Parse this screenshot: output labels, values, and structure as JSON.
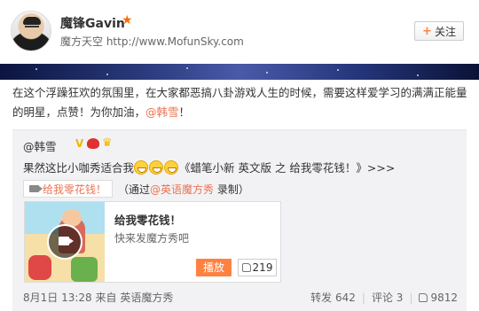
{
  "user": {
    "name": "魔锋Gavin",
    "subtitle": "魔方天空 http://www.MofunSky.com",
    "follow_label": "关注"
  },
  "post": {
    "text_before": "在这个浮躁狂欢的氛围里，在大家都恶搞八卦游戏人生的时候，需要这样爱学习的满满正能量的明星，点赞！为你加油，",
    "mention": "@韩雪",
    "text_after": "！"
  },
  "retweet": {
    "user": "@韩雪",
    "badge_v": "V",
    "text_before": "果然这比小咖秀适合我",
    "text_after": "《蜡笔小新 英文版 之 给我零花钱！》>>>",
    "video_tag": "给我零花钱！",
    "via_prefix": "（通过",
    "via_org": "@英语魔方秀",
    "via_suffix": " 录制）",
    "card": {
      "title": "给我零花钱！",
      "description": "快来发魔方秀吧",
      "play_label": "播放",
      "like_count": "219"
    },
    "footer": {
      "time": "8月1日 13:28",
      "source": "来自 英语魔方秀",
      "repost": "转发 642",
      "comment": "评论 3",
      "likes": "9812"
    }
  },
  "colors": {
    "accent": "#eb7350",
    "play_button": "#ff8140",
    "star": "#ff6a00"
  }
}
